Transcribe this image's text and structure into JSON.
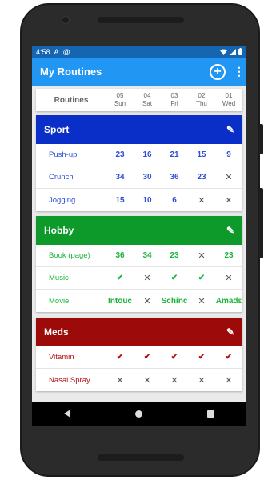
{
  "statusbar": {
    "time": "4:58",
    "icon1": "A",
    "icon2": "@"
  },
  "appbar": {
    "title": "My Routines",
    "add_label": "+",
    "more_label": "⋮"
  },
  "header": {
    "label": "Routines",
    "columns": [
      {
        "num": "05",
        "day": "Sun"
      },
      {
        "num": "04",
        "day": "Sat"
      },
      {
        "num": "03",
        "day": "Fri"
      },
      {
        "num": "02",
        "day": "Thu"
      },
      {
        "num": "01",
        "day": "Wed"
      }
    ]
  },
  "categories": [
    {
      "name": "Sport",
      "color": "#0a2fc9",
      "text_color": "#2e4ed6",
      "rows": [
        {
          "name": "Push-up",
          "cells": [
            "23",
            "16",
            "21",
            "15",
            "9"
          ]
        },
        {
          "name": "Crunch",
          "cells": [
            "34",
            "30",
            "36",
            "23",
            "✕"
          ]
        },
        {
          "name": "Jogging",
          "cells": [
            "15",
            "10",
            "6",
            "✕",
            "✕"
          ]
        }
      ]
    },
    {
      "name": "Hobby",
      "color": "#0e9a2a",
      "text_color": "#19b53a",
      "rows": [
        {
          "name": "Book (page)",
          "cells": [
            "36",
            "34",
            "23",
            "✕",
            "23"
          ]
        },
        {
          "name": "Music",
          "cells": [
            "✔",
            "✕",
            "✔",
            "✔",
            "✕"
          ]
        },
        {
          "name": "Movie",
          "cells": [
            "Intouc",
            "✕",
            "Schinc",
            "✕",
            "Amadε"
          ]
        }
      ]
    },
    {
      "name": "Meds",
      "color": "#9c0a0a",
      "text_color": "#b31212",
      "rows": [
        {
          "name": "Vitamin",
          "cells": [
            "✔",
            "✔",
            "✔",
            "✔",
            "✔"
          ]
        },
        {
          "name": "Nasal Spray",
          "cells": [
            "✕",
            "✕",
            "✕",
            "✕",
            "✕"
          ]
        }
      ]
    }
  ],
  "icons": {
    "edit": "pencil-icon",
    "back": "back-icon",
    "home": "home-icon",
    "recents": "recents-icon"
  }
}
